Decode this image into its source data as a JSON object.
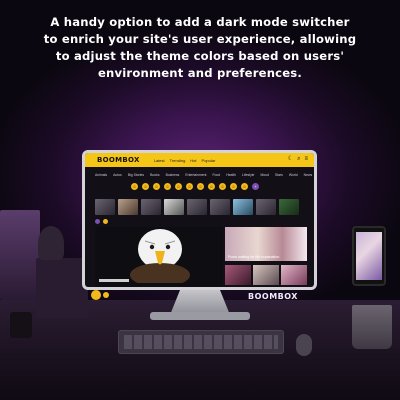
{
  "headline": "A handy option to add a dark mode switcher to enrich your site's user experience, allowing to adjust the theme colors based on users' environment and preferences.",
  "monitor": {
    "logo": "BOOMBOX",
    "top_nav": [
      "Latest",
      "Trending",
      "Hot",
      "Popular"
    ],
    "category_nav": [
      "Animals",
      "Autos",
      "Big Stories",
      "Books",
      "Business",
      "Entertainment",
      "Food",
      "Health",
      "Lifestyle",
      "Mood",
      "Stars",
      "World",
      "News"
    ],
    "featured_caption": "Posts waiting for life explanation"
  },
  "brand_watermark": "BOOMBOX",
  "colors": {
    "accent": "#f5c518",
    "purple": "#7b4fb0",
    "background": "#0b0710"
  }
}
